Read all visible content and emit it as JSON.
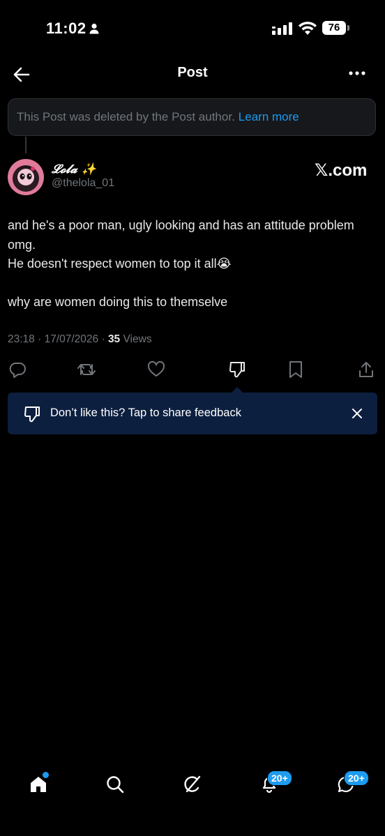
{
  "status_bar": {
    "time": "11:02",
    "battery": "76"
  },
  "header": {
    "title": "Post"
  },
  "deleted_notice": {
    "text": "This Post was deleted by the Post author.",
    "link": "Learn more"
  },
  "post": {
    "author_name": "𝓛𝓸𝓵𝓪 ✨",
    "author_handle": "@thelola_01",
    "source": "𝕏.com",
    "lines": [
      "and he's a poor man, ugly looking and has an attitude problem omg.",
      "He doesn't respect women to top it all😭",
      "why are women doing this to themselve"
    ],
    "time": "23:18",
    "date": "17/07/2026",
    "views_count": "35",
    "views_label": "Views"
  },
  "feedback": {
    "text": "Don’t like this? Tap to share feedback"
  },
  "bottom_nav": {
    "notifications_badge": "20+",
    "messages_badge": "20+"
  },
  "colors": {
    "accent": "#1d9bf0",
    "feedback_bg": "#0d1f3f",
    "muted": "#71767b"
  }
}
